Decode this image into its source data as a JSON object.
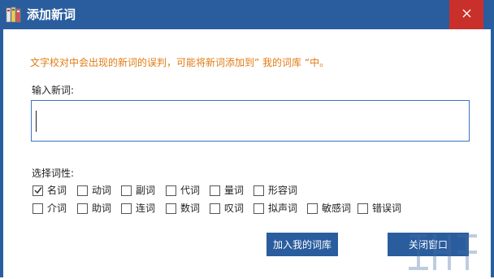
{
  "window": {
    "title": "添加新词"
  },
  "dialog": {
    "hint": "文字校对中会出现的新词的误判，可能将新词添加到” 我的词库 “中。",
    "input_label": "输入新词:",
    "input_value": "",
    "pos_label": "选择词性:",
    "pos_row1": [
      {
        "label": "名词",
        "checked": true
      },
      {
        "label": "动词",
        "checked": false
      },
      {
        "label": "副词",
        "checked": false
      },
      {
        "label": "代词",
        "checked": false
      },
      {
        "label": "量词",
        "checked": false
      },
      {
        "label": "形容词",
        "checked": false
      }
    ],
    "pos_row2": [
      {
        "label": "介词",
        "checked": false
      },
      {
        "label": "助词",
        "checked": false
      },
      {
        "label": "连词",
        "checked": false
      },
      {
        "label": "数词",
        "checked": false
      },
      {
        "label": "叹词",
        "checked": false
      },
      {
        "label": "拟声词",
        "checked": false
      },
      {
        "label": "敏感词",
        "checked": false
      },
      {
        "label": "错误词",
        "checked": false
      }
    ],
    "add_button": "加入我的词库",
    "close_button": "关闭窗口"
  },
  "colors": {
    "titlebar": "#2a5d9e",
    "close": "#c9302c",
    "hint": "#e07b13",
    "button": "#2a5d9e"
  }
}
